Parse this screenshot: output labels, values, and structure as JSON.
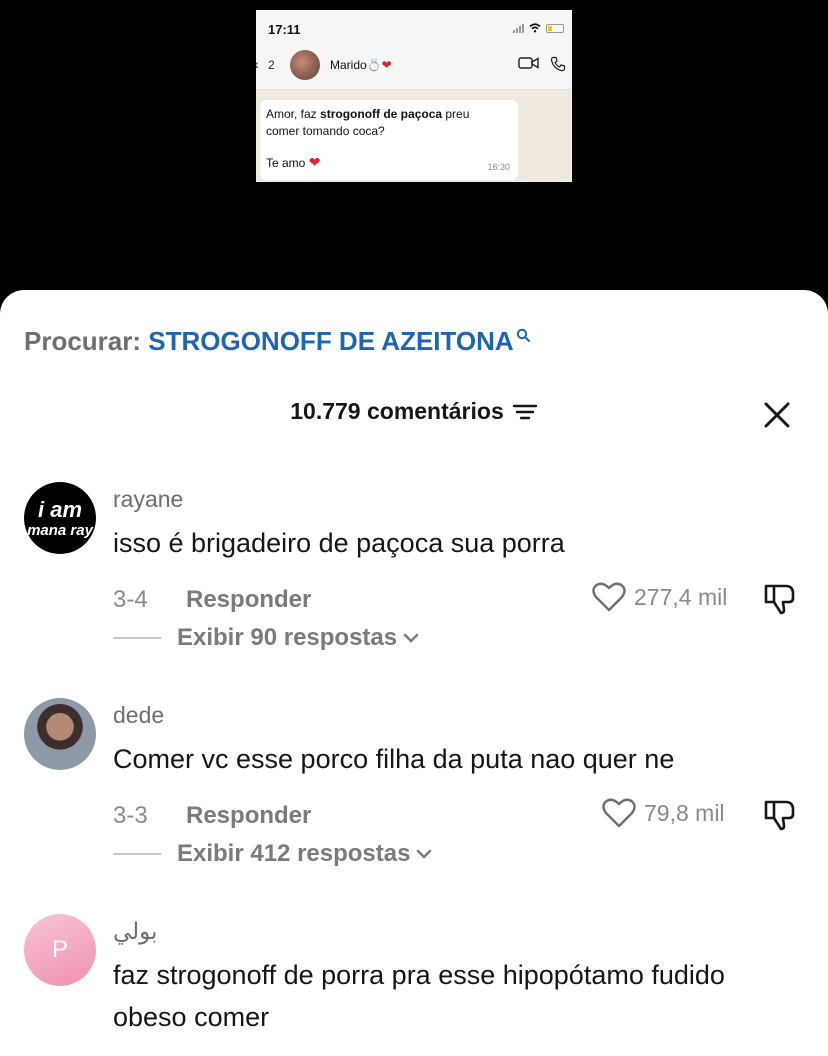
{
  "video": {
    "time": "17:11",
    "chat_back_count": "2",
    "contact_name": "Marido💍",
    "message_line1_prefix": "Amor, faz ",
    "message_line1_bold": "strogonoff de paçoca",
    "message_line1_suffix": "  preu",
    "message_line2": "comer tomando coca?",
    "message_line3": "Te amo",
    "message_time": "16:30"
  },
  "search": {
    "label": "Procurar: ",
    "term": "STROGONOFF DE AZEITONA"
  },
  "header": {
    "comment_count": "10.779 comentários"
  },
  "colors": {
    "search_term": "#1e64b4",
    "primary_text": "#161616",
    "secondary_text": "#8a8a8a"
  },
  "comments": [
    {
      "username": "rayane",
      "avatar_text_1": "i am",
      "avatar_text_2": "mana ray",
      "text": "isso é brigadeiro de paçoca sua porra",
      "date": "3-4",
      "reply_label": "Responder",
      "likes": "277,4 mil",
      "replies_label": "Exibir 90 respostas"
    },
    {
      "username": "dede",
      "text": "Comer vc esse porco filha da puta nao quer ne",
      "date": "3-3",
      "reply_label": "Responder",
      "likes": "79,8 mil",
      "replies_label": "Exibir 412 respostas"
    },
    {
      "username": "بولي",
      "avatar_letter": "P",
      "text": "faz strogonoff de porra pra esse hipopótamo fudido obeso comer"
    }
  ]
}
